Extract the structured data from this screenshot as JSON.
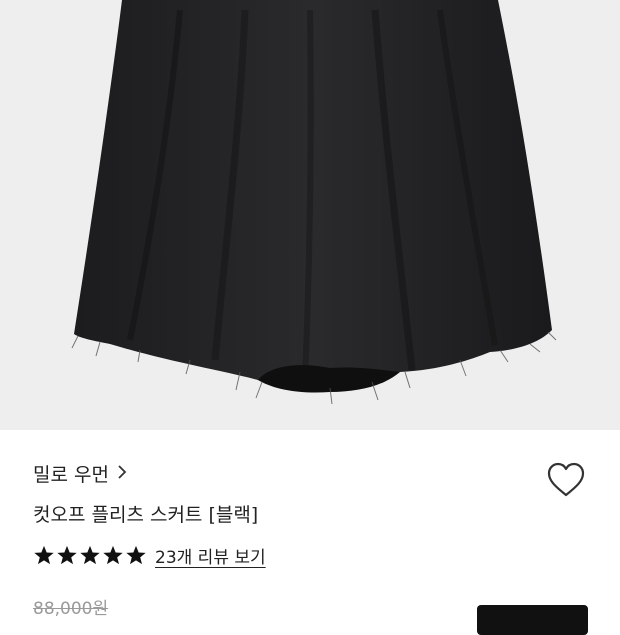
{
  "product": {
    "brand": "밀로 우먼",
    "name": "컷오프 플리츠 스커트 [블랙]",
    "review_link": "23개 리뷰 보기",
    "rating": 5,
    "original_price": "88,000원"
  },
  "icons": {
    "brand_chevron": "chevron-right-icon",
    "wishlist": "heart-outline-icon",
    "star": "star-filled-icon"
  },
  "colors": {
    "skirt": "#242426",
    "background": "#eeeeee",
    "text": "#222222",
    "muted_price": "#9a9a9a",
    "button": "#111111"
  }
}
